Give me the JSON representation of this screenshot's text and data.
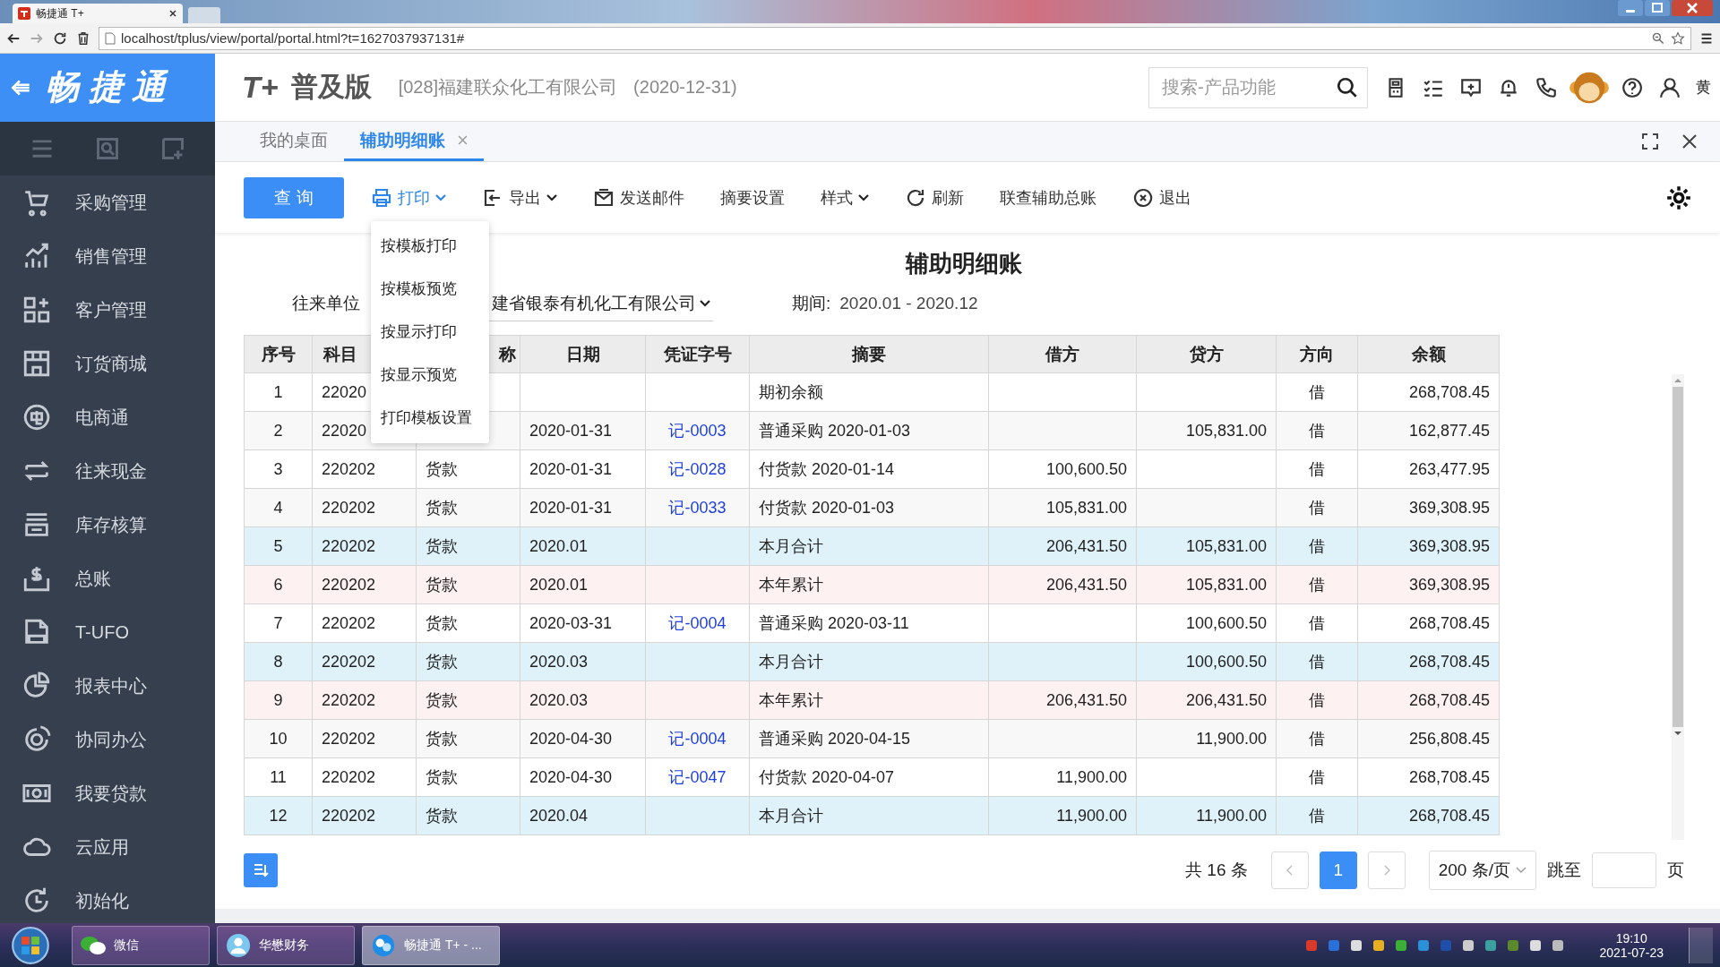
{
  "browser": {
    "tab_title": "畅捷通 T+",
    "url": "localhost/tplus/view/portal/portal.html?t=1627037937131#"
  },
  "header": {
    "logo_text": "畅 捷 通",
    "product_mark": "T+",
    "product": "普及版",
    "company": "[028]福建联众化工有限公司",
    "date": "(2020-12-31)",
    "search": {
      "placeholder": "搜索-产品功能"
    },
    "user": "黄"
  },
  "sidebar": {
    "items": [
      {
        "label": "采购管理"
      },
      {
        "label": "销售管理"
      },
      {
        "label": "客户管理"
      },
      {
        "label": "订货商城"
      },
      {
        "label": "电商通"
      },
      {
        "label": "往来现金"
      },
      {
        "label": "库存核算"
      },
      {
        "label": "总账"
      },
      {
        "label": "T-UFO"
      },
      {
        "label": "报表中心"
      },
      {
        "label": "协同办公"
      },
      {
        "label": "我要贷款"
      },
      {
        "label": "云应用"
      },
      {
        "label": "初始化"
      }
    ]
  },
  "tabs": [
    {
      "label": "我的桌面",
      "selected": false,
      "closable": false
    },
    {
      "label": "辅助明细账",
      "selected": true,
      "closable": true
    }
  ],
  "toolbar": {
    "query_button": "查 询",
    "items": [
      {
        "label": "打印",
        "kind": "menu",
        "expanded": true
      },
      {
        "label": "导出",
        "kind": "menu",
        "expanded": false
      },
      {
        "label": "发送邮件",
        "kind": "button"
      },
      {
        "label": "摘要设置",
        "kind": "button"
      },
      {
        "label": "样式",
        "kind": "menu",
        "expanded": false
      },
      {
        "label": "刷新",
        "kind": "button"
      },
      {
        "label": "联查辅助总账",
        "kind": "button"
      },
      {
        "label": "退出",
        "kind": "button"
      }
    ]
  },
  "print_menu": [
    "按模板打印",
    "按模板预览",
    "按显示打印",
    "按显示预览",
    "打印模板设置"
  ],
  "report": {
    "title": "辅助明细账",
    "filter_label": "往来单位",
    "filter_value": "建省银泰有机化工有限公司",
    "period_label": "期间:",
    "period": "2020.01 - 2020.12"
  },
  "table": {
    "columns": [
      "序号",
      "科目",
      "称",
      "日期",
      "凭证字号",
      "摘要",
      "借方",
      "贷方",
      "方向",
      "余额"
    ],
    "rows": [
      {
        "kind": "entry",
        "cells": [
          "1",
          "22020",
          null,
          null,
          null,
          "期初余额",
          null,
          null,
          "借",
          "268,708.45"
        ]
      },
      {
        "kind": "entry",
        "cells": [
          "2",
          "22020",
          null,
          "2020-01-31",
          "记-0003",
          "普通采购 2020-01-03",
          null,
          "105,831.00",
          "借",
          "162,877.45"
        ]
      },
      {
        "kind": "entry",
        "cells": [
          "3",
          "220202",
          "货款",
          "2020-01-31",
          "记-0028",
          "付货款 2020-01-14",
          "100,600.50",
          null,
          "借",
          "263,477.95"
        ]
      },
      {
        "kind": "entry",
        "cells": [
          "4",
          "220202",
          "货款",
          "2020-01-31",
          "记-0033",
          "付货款 2020-01-03",
          "105,831.00",
          null,
          "借",
          "369,308.95"
        ]
      },
      {
        "kind": "month_total",
        "cells": [
          "5",
          "220202",
          "货款",
          "2020.01",
          null,
          "本月合计",
          "206,431.50",
          "105,831.00",
          "借",
          "369,308.95"
        ]
      },
      {
        "kind": "year_total",
        "cells": [
          "6",
          "220202",
          "货款",
          "2020.01",
          null,
          "本年累计",
          "206,431.50",
          "105,831.00",
          "借",
          "369,308.95"
        ]
      },
      {
        "kind": "entry",
        "cells": [
          "7",
          "220202",
          "货款",
          "2020-03-31",
          "记-0004",
          "普通采购 2020-03-11",
          null,
          "100,600.50",
          "借",
          "268,708.45"
        ]
      },
      {
        "kind": "month_total",
        "cells": [
          "8",
          "220202",
          "货款",
          "2020.03",
          null,
          "本月合计",
          null,
          "100,600.50",
          "借",
          "268,708.45"
        ]
      },
      {
        "kind": "year_total",
        "cells": [
          "9",
          "220202",
          "货款",
          "2020.03",
          null,
          "本年累计",
          "206,431.50",
          "206,431.50",
          "借",
          "268,708.45"
        ]
      },
      {
        "kind": "entry",
        "cells": [
          "10",
          "220202",
          "货款",
          "2020-04-30",
          "记-0004",
          "普通采购 2020-04-15",
          null,
          "11,900.00",
          "借",
          "256,808.45"
        ]
      },
      {
        "kind": "entry",
        "cells": [
          "11",
          "220202",
          "货款",
          "2020-04-30",
          "记-0047",
          "付货款 2020-04-07",
          "11,900.00",
          null,
          "借",
          "268,708.45"
        ]
      },
      {
        "kind": "month_total",
        "cells": [
          "12",
          "220202",
          "货款",
          "2020.04",
          null,
          "本月合计",
          "11,900.00",
          "11,900.00",
          "借",
          "268,708.45"
        ]
      }
    ]
  },
  "pagination": {
    "total": "共 16 条",
    "pages": [
      {
        "label": "1",
        "selected": true
      }
    ],
    "page_size": "200 条/页",
    "jump_label": "跳至",
    "page_suffix": "页"
  },
  "taskbar": {
    "items": [
      {
        "label": "微信",
        "selected": false
      },
      {
        "label": "华懋财务",
        "selected": false
      },
      {
        "label": "畅捷通 T+ - ...",
        "selected": true
      }
    ],
    "time": "19:10",
    "date": "2021-07-23"
  }
}
